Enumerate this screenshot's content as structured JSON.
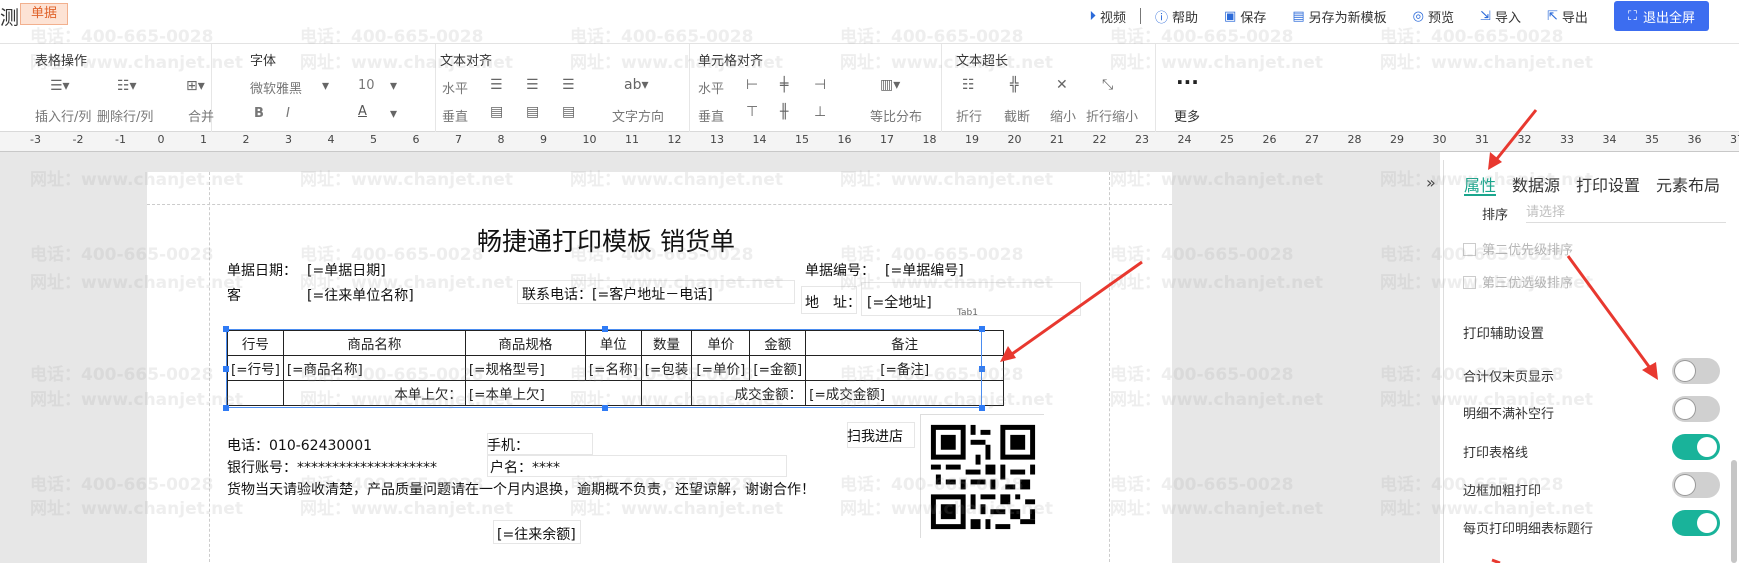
{
  "app": {
    "title": "测",
    "doc_badge": "单据"
  },
  "top_actions": [
    {
      "label": "视频",
      "icon": "play-circle-icon"
    },
    {
      "label": "帮助",
      "icon": "question-circle-icon"
    },
    {
      "label": "保存",
      "icon": "save-icon"
    },
    {
      "label": "另存为新模板",
      "icon": "save-as-icon"
    },
    {
      "label": "预览",
      "icon": "preview-icon"
    },
    {
      "label": "导入",
      "icon": "import-icon"
    },
    {
      "label": "导出",
      "icon": "export-icon"
    }
  ],
  "fullscreen_btn": "退出全屏",
  "toolbar": {
    "table_ops": {
      "title": "表格操作",
      "insert": "插入行/列",
      "delete": "删除行/列",
      "merge": "合并"
    },
    "font": {
      "title": "字体",
      "family": "微软雅黑",
      "size": "10",
      "bold": "B",
      "italic": "I",
      "color": "A"
    },
    "text_align": {
      "title": "文本对齐",
      "horizontal": "水平",
      "vertical": "垂直",
      "direction": "文字方向"
    },
    "cell_align": {
      "title": "单元格对齐",
      "horizontal": "水平",
      "vertical": "垂直",
      "distribute": "等比分布"
    },
    "overflow": {
      "title": "文本超长",
      "wrap": "折行",
      "cut": "截断",
      "shrink": "缩小",
      "wrap_shrink": "折行缩小"
    },
    "more": {
      "dots": "···",
      "label": "更多"
    }
  },
  "ruler": [
    "-3",
    "-2",
    "-1",
    "0",
    "1",
    "2",
    "3",
    "4",
    "5",
    "6",
    "7",
    "8",
    "9",
    "10",
    "11",
    "12",
    "13",
    "14",
    "15",
    "16",
    "17",
    "18",
    "19",
    "20",
    "21",
    "22",
    "23",
    "24",
    "25",
    "26",
    "27",
    "28",
    "29",
    "30",
    "31",
    "32",
    "33",
    "34",
    "35",
    "36",
    "37"
  ],
  "paper": {
    "title": "畅捷通打印模板 销货单",
    "date_label": "单据日期：",
    "date_value": "[=单据日期]",
    "number_label": "单据编号：",
    "number_value": "[=单据编号]",
    "customer_label": "客",
    "customer_value": "[=往来单位名称]",
    "contact_phone": "联系电话：[=客户地址－电话]",
    "address_label": "地　址：",
    "address_value": "[=全地址]",
    "tab_label": "Tab1",
    "table": {
      "headers": [
        "行号",
        "商品名称",
        "商品规格",
        "单位",
        "数量",
        "单价",
        "金额",
        "备注"
      ],
      "row": [
        "[=行号]",
        "[=商品名称]",
        "[=规格型号]",
        "[=名称]",
        "[=包装",
        "[=单价]",
        "[=金额]",
        "[=备注]"
      ],
      "footer": {
        "prev_owe_label": "本单上欠：",
        "prev_owe_value": "[=本单上欠]",
        "deal_label": "成交金额：",
        "deal_value": "[=成交金额]"
      }
    },
    "phone": "电话：010-62430001",
    "mobile": "手机：",
    "bank": "银行账号：********************",
    "account_name": "户名：****",
    "scan_label": "扫我进店",
    "notice": "货物当天请验收清楚，产品质量问题请在一个月内退换，逾期概不负责，还望谅解，谢谢合作！",
    "balance": "[=往来余额]"
  },
  "panel": {
    "tabs": [
      "属性",
      "数据源",
      "打印设置",
      "元素布局"
    ],
    "sort_label": "排序",
    "sort_placeholder": "请选择",
    "second_sort": "第二优先级排序",
    "third_sort": "第三优选级排序",
    "section_title": "打印辅助设置",
    "toggles": [
      {
        "label": "合计仅末页显示",
        "on": false
      },
      {
        "label": "明细不满补空行",
        "on": false
      },
      {
        "label": "打印表格线",
        "on": true
      },
      {
        "label": "边框加粗打印",
        "on": false
      },
      {
        "label": "每页打印明细表标题行",
        "on": true
      }
    ]
  },
  "watermark": {
    "phone": "电话：400-665-0028",
    "url": "网址：www.chanjet.net"
  },
  "colors": {
    "accent": "#3c6df0",
    "teal": "#19b39a",
    "arrow": "#e8382f",
    "badge": "#e0632b"
  }
}
